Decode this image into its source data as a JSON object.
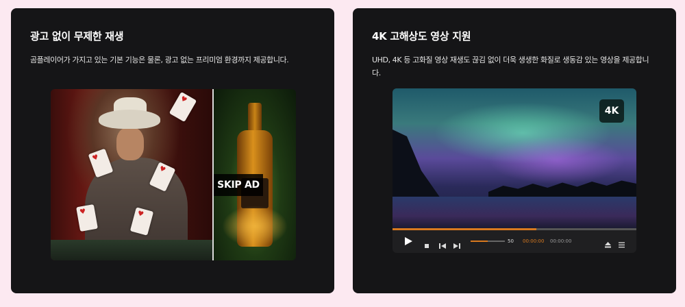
{
  "cards": [
    {
      "title": "광고 없이 무제한 재생",
      "description": "곰플레이어가 가지고 있는 기본 기능은 물론, 광고 없는 프리미엄 환경까지 제공합니다.",
      "skip_button_label": "SKIP AD"
    },
    {
      "title": "4K 고해상도 영상 지원",
      "description": "UHD, 4K 등 고화질 영상 재생도 끊김 없이 더욱 생생한 화질로 생동감 있는 영상을 제공합니다.",
      "badge_label": "4K",
      "player": {
        "volume_value": "50",
        "current_time": "00:00:00",
        "total_time": "00:00:00",
        "progress_fraction": 0.59,
        "volume_fraction": 0.5
      }
    }
  ],
  "colors": {
    "page_background": "#fce9f1",
    "card_background": "#151517",
    "accent": "#d97a1f"
  },
  "icons": [
    "play-icon",
    "stop-icon",
    "previous-icon",
    "next-icon",
    "eject-icon",
    "menu-icon"
  ]
}
